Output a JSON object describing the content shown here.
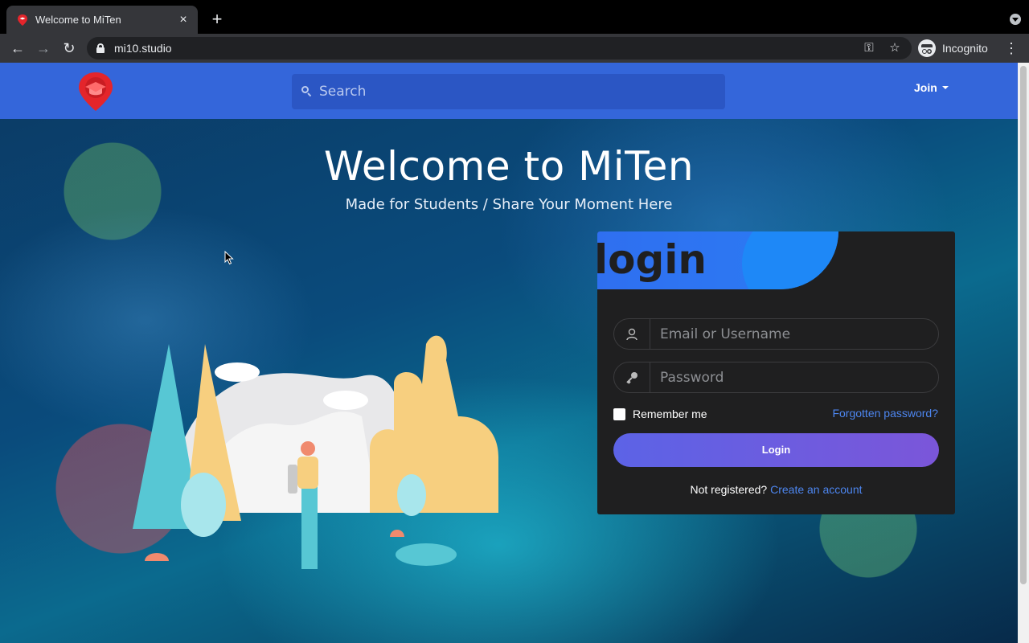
{
  "browser": {
    "tab_title": "Welcome to MiTen",
    "url": "mi10.studio",
    "profile_label": "Incognito"
  },
  "navbar": {
    "search_placeholder": "Search",
    "join_label": "Join"
  },
  "hero": {
    "title": "Welcome to MiTen",
    "subtitle": "Made for Students / Share Your Moment Here"
  },
  "login": {
    "title": "login",
    "email_placeholder": "Email or Username",
    "password_placeholder": "Password",
    "remember_label": "Remember me",
    "forgot_label": "Forgotten password?",
    "button_label": "Login",
    "register_question": "Not registered?",
    "register_link": "Create an account"
  },
  "colors": {
    "navbar": "#3466da",
    "card": "#1f1f20",
    "accent_link": "#4d86f0",
    "brand_red": "#e4252b"
  }
}
